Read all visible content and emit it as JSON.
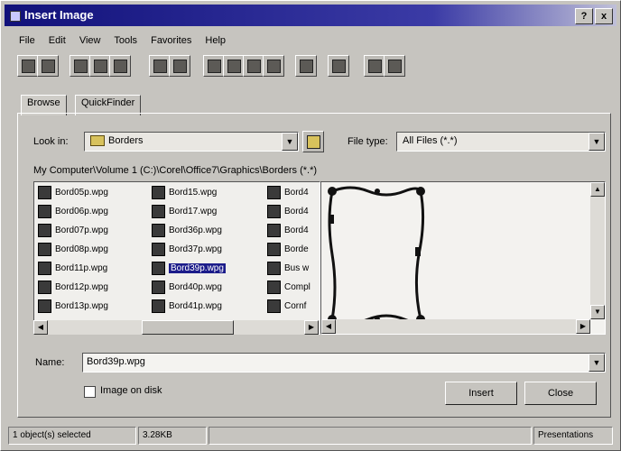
{
  "window": {
    "title": "Insert Image"
  },
  "titlebar": {
    "help_glyph": "?",
    "close_glyph": "x"
  },
  "menu": [
    "File",
    "Edit",
    "View",
    "Tools",
    "Favorites",
    "Help"
  ],
  "tabs": [
    "Browse",
    "QuickFinder"
  ],
  "look_in": {
    "label": "Look in:",
    "value": "Borders"
  },
  "file_type": {
    "label": "File type:",
    "value": "All Files (*.*)"
  },
  "path": "My Computer\\Volume 1 (C:)\\Corel\\Office7\\Graphics\\Borders (*.*)",
  "files": {
    "col1": [
      "Bord05p.wpg",
      "Bord06p.wpg",
      "Bord07p.wpg",
      "Bord08p.wpg",
      "Bord11p.wpg",
      "Bord12p.wpg",
      "Bord13p.wpg"
    ],
    "col2": [
      "Bord15.wpg",
      "Bord17.wpg",
      "Bord36p.wpg",
      "Bord37p.wpg",
      "Bord39p.wpg",
      "Bord40p.wpg",
      "Bord41p.wpg"
    ],
    "col3": [
      "Bord4",
      "Bord4",
      "Bord4",
      "Borde",
      "Bus w",
      "Compl",
      "Cornf"
    ],
    "selected": "Bord39p.wpg"
  },
  "name": {
    "label": "Name:",
    "value": "Bord39p.wpg"
  },
  "image_on_disk": {
    "label": "Image on disk",
    "checked": false
  },
  "buttons": {
    "insert": "Insert",
    "close": "Close"
  },
  "status": {
    "selected": "1 object(s) selected",
    "size": "3.28KB",
    "right": "Presentations"
  },
  "colors": {
    "title_start": "#11117a",
    "title_end": "#c0c0d8",
    "selection": "#1c1c8a",
    "face": "#c6c4bf"
  }
}
